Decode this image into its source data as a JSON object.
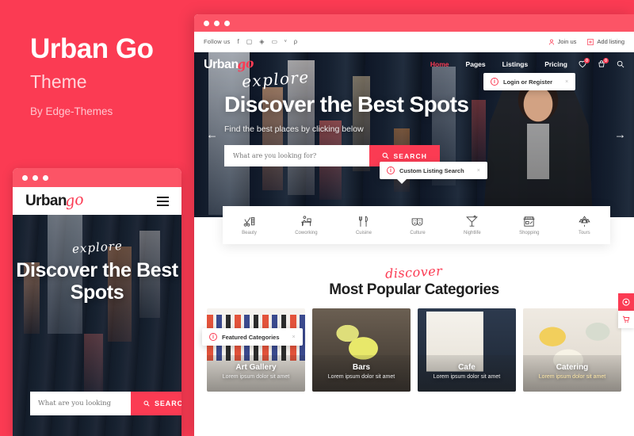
{
  "promo": {
    "title": "Urban Go",
    "subtitle": "Theme",
    "byline": "By Edge-Themes"
  },
  "colors": {
    "brand_pink": "#FB3B53",
    "browser_bar": "#FC5466",
    "heading_dark": "#1F1F1F"
  },
  "brand": {
    "word": "Urban",
    "script": "go"
  },
  "topbar": {
    "follow_label": "Follow us",
    "socials": [
      "facebook-icon",
      "instagram-icon",
      "twitter-icon",
      "youtube-icon",
      "vimeo-icon",
      "pinterest-icon"
    ],
    "join_label": "Join us",
    "add_listing_label": "Add listing"
  },
  "nav": {
    "links": [
      {
        "label": "Home",
        "active": true
      },
      {
        "label": "Pages",
        "active": false
      },
      {
        "label": "Listings",
        "active": false
      },
      {
        "label": "Pricing",
        "active": false
      }
    ],
    "icons": [
      "heart-icon",
      "cart-icon",
      "search-icon"
    ],
    "heart_badge": "0",
    "cart_badge": "0"
  },
  "hero": {
    "script": "explore",
    "heading": "Discover the Best Spots",
    "subtitle": "Find the best places by clicking below",
    "search_placeholder": "What are you looking for?",
    "search_button": "SEARCH",
    "prev_arrow": "arrow-left-icon",
    "next_arrow": "arrow-right-icon"
  },
  "tooltips": [
    {
      "text": "Login or Register",
      "close": "×"
    },
    {
      "text": "Custom Listing Search",
      "close": "×"
    },
    {
      "text": "Featured Categories",
      "close": "×"
    }
  ],
  "categories_strip": [
    {
      "label": "Beauty",
      "icon": "scissors-comb-icon"
    },
    {
      "label": "Coworking",
      "icon": "desk-person-icon"
    },
    {
      "label": "Cuisine",
      "icon": "fork-knife-icon"
    },
    {
      "label": "Culture",
      "icon": "theatre-masks-icon"
    },
    {
      "label": "Nightlife",
      "icon": "cocktail-icon"
    },
    {
      "label": "Shopping",
      "icon": "storefront-icon"
    },
    {
      "label": "Tours",
      "icon": "trees-icon"
    }
  ],
  "popular": {
    "script": "discover",
    "heading": "Most Popular Categories",
    "cards": [
      {
        "title": "Art Gallery",
        "desc": "Lorem ipsum dolor sit amet"
      },
      {
        "title": "Bars",
        "desc": "Lorem ipsum dolor sit amet"
      },
      {
        "title": "Cafe",
        "desc": "Lorem ipsum dolor sit amet"
      },
      {
        "title": "Catering",
        "desc": "Lorem ipsum dolor sit amet"
      }
    ]
  },
  "mobile": {
    "script": "explore",
    "heading": "Discover the Best Spots",
    "search_placeholder": "What are you looking",
    "search_button": "SEARCH",
    "menu_icon": "hamburger-icon"
  },
  "rail": [
    {
      "icon": "purchase-icon"
    },
    {
      "icon": "cart-icon"
    }
  ]
}
